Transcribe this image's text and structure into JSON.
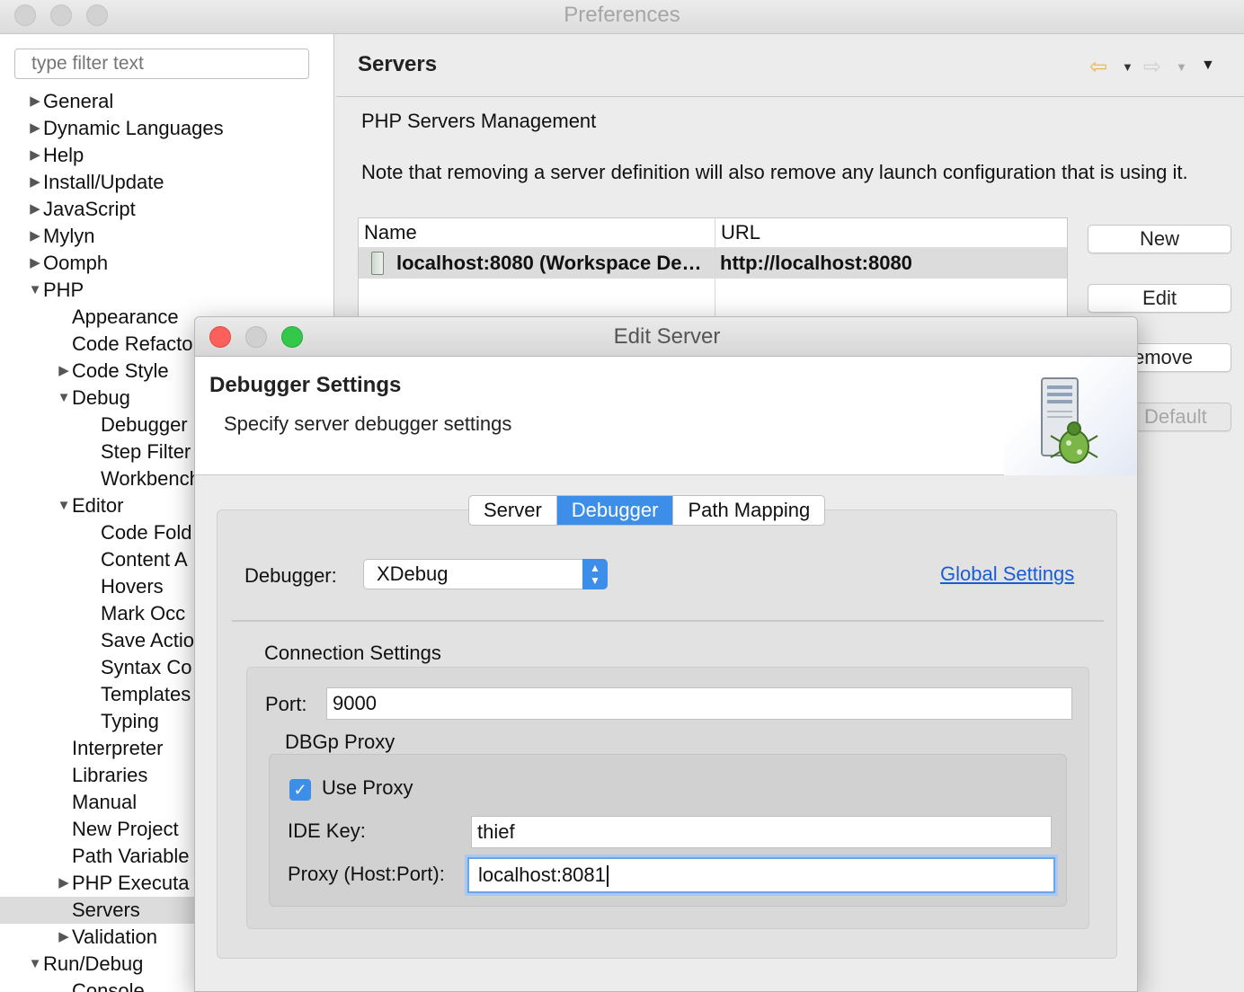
{
  "preferences": {
    "title": "Preferences",
    "filter_placeholder": "type filter text",
    "tree": [
      {
        "label": "General",
        "expanded": false
      },
      {
        "label": "Dynamic Languages",
        "expanded": false
      },
      {
        "label": "Help",
        "expanded": false
      },
      {
        "label": "Install/Update",
        "expanded": false
      },
      {
        "label": "JavaScript",
        "expanded": false
      },
      {
        "label": "Mylyn",
        "expanded": false
      },
      {
        "label": "Oomph",
        "expanded": false
      },
      {
        "label": "PHP",
        "expanded": true
      },
      {
        "label": "Appearance"
      },
      {
        "label": "Code Refacto"
      },
      {
        "label": "Code Style",
        "expanded": false
      },
      {
        "label": "Debug",
        "expanded": true
      },
      {
        "label": "Debugger"
      },
      {
        "label": "Step Filter"
      },
      {
        "label": "Workbench"
      },
      {
        "label": "Editor",
        "expanded": true
      },
      {
        "label": "Code Fold"
      },
      {
        "label": "Content A"
      },
      {
        "label": "Hovers"
      },
      {
        "label": "Mark Occ"
      },
      {
        "label": "Save Actio"
      },
      {
        "label": "Syntax Co"
      },
      {
        "label": "Templates"
      },
      {
        "label": "Typing"
      },
      {
        "label": "Interpreter"
      },
      {
        "label": "Libraries"
      },
      {
        "label": "Manual"
      },
      {
        "label": "New Project"
      },
      {
        "label": "Path Variable"
      },
      {
        "label": "PHP Executa",
        "expanded": false
      },
      {
        "label": "Servers",
        "selected": true
      },
      {
        "label": "Validation",
        "expanded": false
      },
      {
        "label": "Run/Debug",
        "expanded": true
      },
      {
        "label": "Console"
      }
    ]
  },
  "servers_page": {
    "title": "Servers",
    "section_title": "PHP Servers Management",
    "note": "Note that removing a server definition will also remove any launch configuration that is using it.",
    "table": {
      "columns": [
        "Name",
        "URL"
      ],
      "rows": [
        {
          "name": "localhost:8080 (Workspace De…",
          "url": "http://localhost:8080"
        }
      ]
    },
    "buttons": {
      "new": "New",
      "edit": "Edit",
      "remove": "emove",
      "default": "Default"
    }
  },
  "dialog": {
    "title": "Edit Server",
    "heading": "Debugger Settings",
    "subheading": "Specify server debugger settings",
    "tabs": [
      "Server",
      "Debugger",
      "Path Mapping"
    ],
    "active_tab": "Debugger",
    "debugger_label": "Debugger:",
    "debugger_value": "XDebug",
    "global_settings_link": "Global Settings",
    "connection_settings_label": "Connection Settings",
    "port_label": "Port:",
    "port_value": "9000",
    "proxy_group_label": "DBGp Proxy",
    "use_proxy_label": "Use Proxy",
    "use_proxy_checked": true,
    "ide_key_label": "IDE Key:",
    "ide_key_value": "thief",
    "proxy_label": "Proxy (Host:Port):",
    "proxy_value": "localhost:8081"
  },
  "colors": {
    "accent": "#3d8ee8",
    "link": "#1a5cd8",
    "close": "#fc605c",
    "minimize": "#d0d0d0",
    "maximize": "#34c84a"
  }
}
